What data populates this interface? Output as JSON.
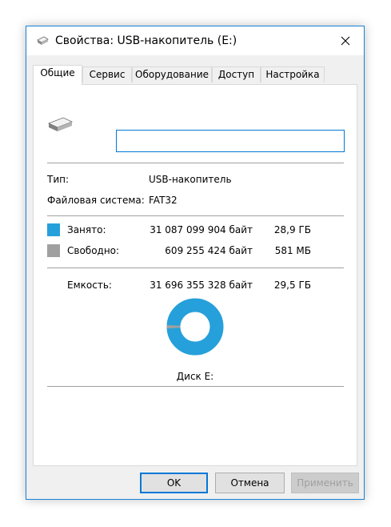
{
  "window": {
    "title": "Свойства: USB-накопитель (E:)",
    "accent_color": "#1883d7"
  },
  "tabs": [
    {
      "label": "Общие",
      "active": true
    },
    {
      "label": "Сервис",
      "active": false
    },
    {
      "label": "Оборудование",
      "active": false
    },
    {
      "label": "Доступ",
      "active": false
    },
    {
      "label": "Настройка",
      "active": false
    }
  ],
  "general": {
    "name_value": "",
    "type_label": "Тип:",
    "type_value": "USB-накопитель",
    "fs_label": "Файловая система:",
    "fs_value": "FAT32",
    "used": {
      "label": "Занято:",
      "bytes": "31 087 099 904 байт",
      "size": "28,9 ГБ",
      "color": "#26a0da",
      "fraction": 0.9808
    },
    "free": {
      "label": "Свободно:",
      "bytes": "609 255 424 байт",
      "size": "581 МБ",
      "color": "#a0a0a0",
      "fraction": 0.0192
    },
    "capacity": {
      "label": "Емкость:",
      "bytes": "31 696 355 328 байт",
      "size": "29,5 ГБ"
    },
    "disk_label": "Диск E:"
  },
  "buttons": {
    "ok": "OK",
    "cancel": "Отмена",
    "apply": "Применить"
  },
  "icons": {
    "title": "usb-drive-icon",
    "close": "close-icon",
    "drive": "usb-drive-icon"
  }
}
